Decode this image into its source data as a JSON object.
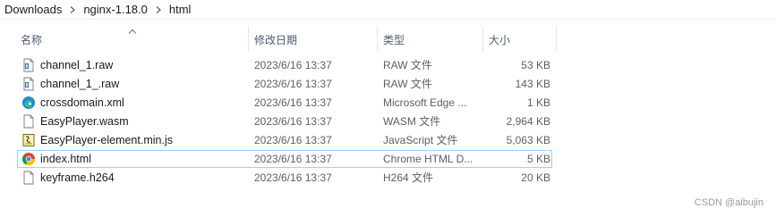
{
  "breadcrumb": [
    "Downloads",
    "nginx-1.18.0",
    "html"
  ],
  "columns": {
    "name": "名称",
    "date": "修改日期",
    "type": "类型",
    "size": "大小"
  },
  "files": [
    {
      "name": "channel_1.raw",
      "date": "2023/6/16 13:37",
      "type": "RAW 文件",
      "size": "53 KB",
      "icon": "raw-file-icon"
    },
    {
      "name": "channel_1_.raw",
      "date": "2023/6/16 13:37",
      "type": "RAW 文件",
      "size": "143 KB",
      "icon": "raw-file-icon"
    },
    {
      "name": "crossdomain.xml",
      "date": "2023/6/16 13:37",
      "type": "Microsoft Edge ...",
      "size": "1 KB",
      "icon": "edge-icon"
    },
    {
      "name": "EasyPlayer.wasm",
      "date": "2023/6/16 13:37",
      "type": "WASM 文件",
      "size": "2,964 KB",
      "icon": "blank-file-icon"
    },
    {
      "name": "EasyPlayer-element.min.js",
      "date": "2023/6/16 13:37",
      "type": "JavaScript 文件",
      "size": "5,063 KB",
      "icon": "script-file-icon"
    },
    {
      "name": "index.html",
      "date": "2023/6/16 13:37",
      "type": "Chrome HTML D...",
      "size": "5 KB",
      "icon": "chrome-icon"
    },
    {
      "name": "keyframe.h264",
      "date": "2023/6/16 13:37",
      "type": "H264 文件",
      "size": "20 KB",
      "icon": "blank-file-icon"
    }
  ],
  "selected_index": 5,
  "watermark": "CSDN @aibujin",
  "colors": {
    "selection_border": "#99d1ff",
    "header_text": "#4d5d6d",
    "detail_text": "#5f5f5f"
  }
}
